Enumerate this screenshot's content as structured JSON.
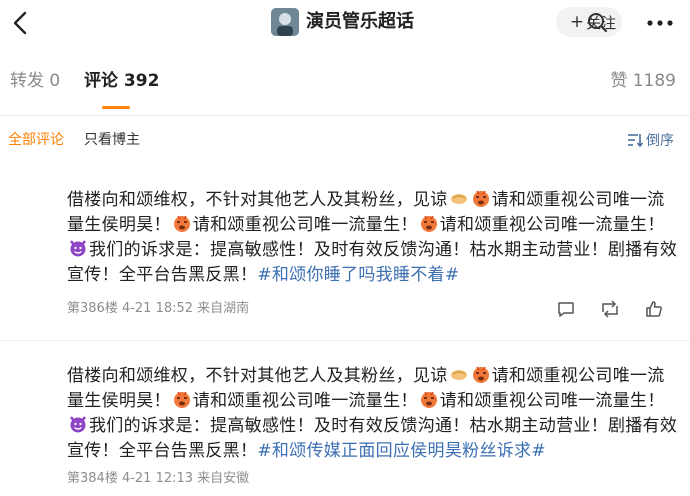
{
  "header": {
    "topic_title": "演员管乐超话",
    "follow_label": "关注",
    "colors": {
      "accent": "#ff8200",
      "link": "#3c6fb3"
    }
  },
  "tabs": {
    "repost": {
      "label": "转发",
      "count": "0"
    },
    "comment": {
      "label": "评论",
      "count": "392"
    },
    "like": {
      "label": "赞",
      "count": "1189"
    }
  },
  "filters": {
    "all": "全部评论",
    "owner_only": "只看博主",
    "sort": "倒序"
  },
  "comments": [
    {
      "p1": "借楼向和颂维权，不针对其他艺人及其粉丝，见谅",
      "p2": "请和颂重视公司唯一流量生侯明昊！",
      "p3": "请和颂重视公司唯一流量生！",
      "p4": "请和颂重视公司唯一流量生！",
      "p5": "我们的诉求是：提高敏感性！及时有效反馈沟通！枯水期主动营业！剧播有效宣传！全平台告黑反黑！",
      "hashtag": "#和颂你睡了吗我睡不着#",
      "meta": "第386楼  4-21 18:52  来自湖南"
    },
    {
      "p1": "借楼向和颂维权，不针对其他艺人及其粉丝，见谅",
      "p2": "请和颂重视公司唯一流量生侯明昊！",
      "p3": "请和颂重视公司唯一流量生！",
      "p4": "请和颂重视公司唯一流量生！",
      "p5": "我们的诉求是：提高敏感性！及时有效反馈沟通！枯水期主动营业！剧播有效宣传！全平台告黑反黑！",
      "hashtag": "#和颂传媒正面回应侯明昊粉丝诉求#",
      "meta": "第384楼  4-21 12:13  来自安徽"
    }
  ],
  "icons": [
    "back-arrow-icon",
    "search-icon",
    "more-icon",
    "sort-icon",
    "reply-icon",
    "repost-icon",
    "like-icon",
    "handshake-emoji-icon",
    "angry-emoji-icon",
    "devil-emoji-icon"
  ]
}
